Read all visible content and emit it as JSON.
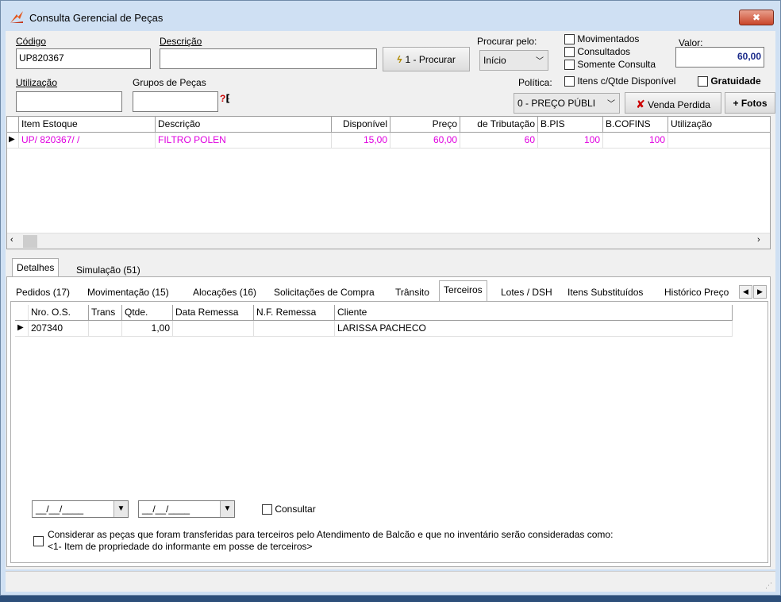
{
  "window": {
    "title": "Consulta Gerencial de Peças",
    "close_glyph": "✖"
  },
  "search": {
    "codigo_label": "Código",
    "codigo_value": "UP820367",
    "descricao_label": "Descrição",
    "descricao_value": "",
    "procurar_button": "1 - Procurar",
    "procurar_pelo_label": "Procurar pelo:",
    "procurar_pelo_value": "Início",
    "movimentados_label": "Movimentados",
    "consultados_label": "Consultados",
    "somente_consulta_label": "Somente Consulta",
    "valor_label": "Valor:",
    "valor_value": "60,00",
    "utilizacao_label": "Utilização",
    "utilizacao_value": "",
    "grupos_label": "Grupos de Peças",
    "grupos_value": "",
    "politica_label": "Política:",
    "politica_value": "0 - PREÇO PÚBLI",
    "itens_qtde_label": "Itens c/Qtde Disponível",
    "gratuidade_label": "Gratuidade",
    "venda_perdida_button": "Venda Perdida",
    "fotos_button": "+ Fotos"
  },
  "items_grid": {
    "columns": [
      "Item Estoque",
      "Descrição",
      "Disponível",
      "Preço",
      "de Tributação",
      "B.PIS",
      "B.COFINS",
      "Utilização"
    ],
    "rows": [
      [
        "UP/ 820367/ /",
        "FILTRO POLEN",
        "15,00",
        "60,00",
        "60",
        "100",
        "100",
        ""
      ]
    ]
  },
  "main_tabs": [
    "Detalhes",
    "Simulação (51)"
  ],
  "sub_tabs": [
    "Pedidos (17)",
    "Movimentação (15)",
    "Alocações (16)",
    "Solicitações de Compra",
    "Trânsito",
    "Terceiros",
    "Lotes / DSH",
    "Itens Substituídos",
    "Histórico Preço"
  ],
  "terceiros_grid": {
    "columns": [
      "Nro. O.S.",
      "Trans",
      "Qtde.",
      "Data Remessa",
      "N.F. Remessa",
      "Cliente"
    ],
    "rows": [
      [
        "207340",
        "",
        "1,00",
        "",
        "",
        "LARISSA PACHECO"
      ]
    ]
  },
  "filters": {
    "date1": "__/__/____",
    "date2": "__/__/____",
    "consultar_label": "Consultar",
    "considerar_line1": "Considerar as peças que foram transferidas para terceiros pelo Atendimento de Balcão e que no inventário serão consideradas como:",
    "considerar_line2": "<1- Item de propriedade do informante em posse de terceiros>"
  },
  "colors": {
    "pink_row": "#e000e0",
    "valor_blue": "#1a2a8a",
    "window_bg": "#cfe0f3"
  }
}
